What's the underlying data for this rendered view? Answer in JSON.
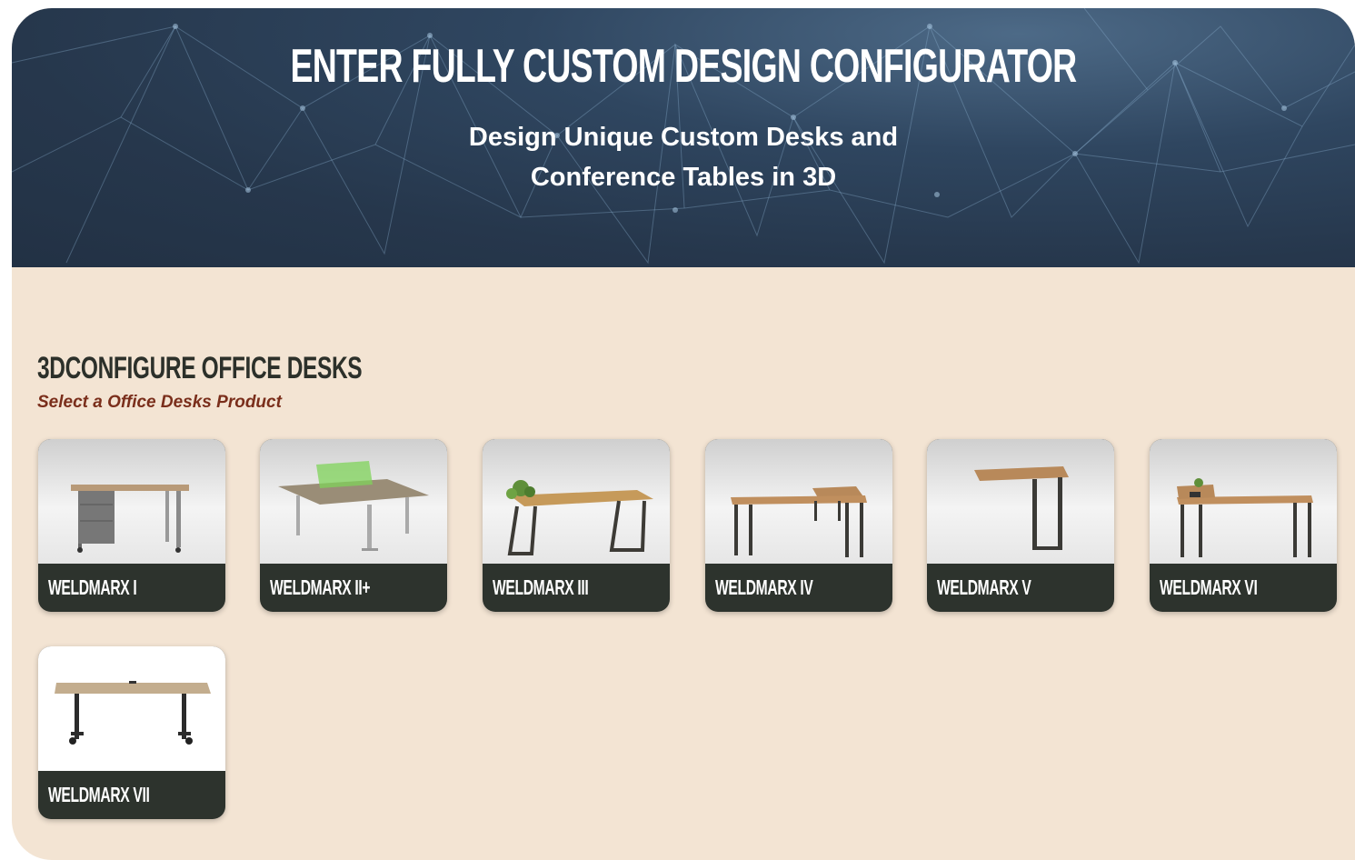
{
  "hero": {
    "title": "ENTER FULLY CUSTOM DESIGN CONFIGURATOR",
    "subtitle_line1": "Design Unique Custom Desks and",
    "subtitle_line2": "Conference Tables in 3D"
  },
  "section": {
    "title": "3DCONFIGURE OFFICE DESKS",
    "subtitle": "Select a Office Desks Product"
  },
  "products": [
    {
      "label": "WELDMARX I"
    },
    {
      "label": "WELDMARX II+"
    },
    {
      "label": "WELDMARX III"
    },
    {
      "label": "WELDMARX IV"
    },
    {
      "label": "WELDMARX V"
    },
    {
      "label": "WELDMARX VI"
    },
    {
      "label": "WELDMARX VII"
    }
  ],
  "colors": {
    "hero_bg": "#26374c",
    "section_bg": "#f3e4d3",
    "card_label_bg": "#2d332d",
    "subtitle_accent": "#7a2e1b"
  }
}
